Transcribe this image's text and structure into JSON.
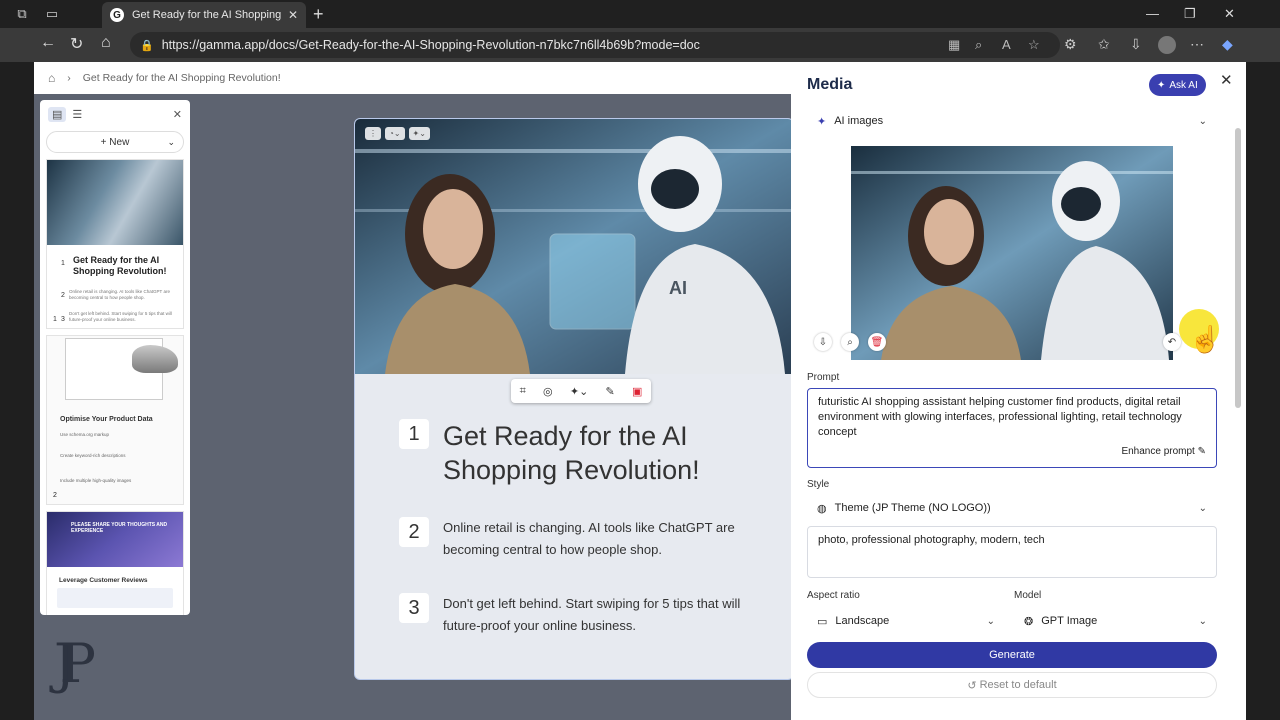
{
  "browser": {
    "tab_title": "Get Ready for the AI Shopping Re",
    "url": "https://gamma.app/docs/Get-Ready-for-the-AI-Shopping-Revolution-n7bkc7n6ll4b69b?mode=doc"
  },
  "breadcrumb": {
    "current": "Get Ready for the AI Shopping Revolution!"
  },
  "sidebar": {
    "new_label": "New",
    "thumb1": {
      "item1_num": "1",
      "title": "Get Ready for the AI Shopping Revolution!",
      "item2_num": "2",
      "item2_text": "Online retail is changing. AI tools like ChatGPT are becoming central to how people shop.",
      "item3_num": "3",
      "item3_text": "Don't get left behind. Start swiping for 5 tips that will future-proof your online business.",
      "slide_no": "1"
    },
    "thumb2": {
      "title": "Optimise Your Product Data",
      "items": [
        "Use schema.org markup",
        "Create keyword-rich descriptions",
        "Include multiple high-quality images"
      ],
      "slide_no": "2"
    },
    "thumb3": {
      "poster_text": "PLEASE SHARE YOUR THOUGHTS AND EXPERIENCE",
      "title": "Leverage Customer Reviews"
    }
  },
  "card": {
    "items": [
      {
        "num": "1",
        "text": "Get Ready for the AI Shopping Revolution!"
      },
      {
        "num": "2",
        "text": "Online retail is changing. AI tools like ChatGPT are becoming central to how people shop."
      },
      {
        "num": "3",
        "text": "Don't get left behind. Start swiping for 5 tips that will future-proof your online business."
      }
    ]
  },
  "panel": {
    "title": "Media",
    "ask_ai": "Ask AI",
    "source": "AI images",
    "prompt_label": "Prompt",
    "prompt_text": "futuristic AI shopping assistant helping customer find products, digital retail environment with glowing interfaces, professional lighting, retail technology concept",
    "enhance": "Enhance prompt",
    "style_label": "Style",
    "style_value": "Theme (JP Theme (NO LOGO))",
    "style_keywords": "photo, professional photography, modern, tech",
    "aspect_label": "Aspect ratio",
    "aspect_value": "Landscape",
    "model_label": "Model",
    "model_value": "GPT Image",
    "generate": "Generate",
    "reset": "Reset to default"
  },
  "colors": {
    "accent": "#3039a4",
    "page_bg": "#5d6370",
    "card_bg": "#e7eaf0"
  }
}
